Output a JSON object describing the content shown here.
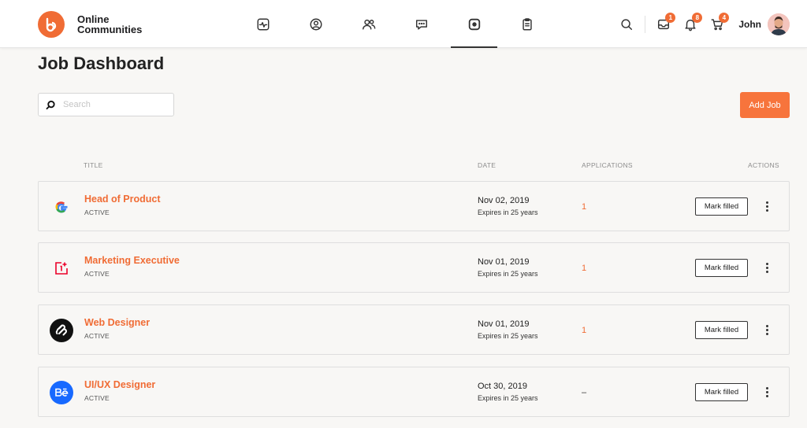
{
  "brand": {
    "line1": "Online",
    "line2": "Communities"
  },
  "nav": [
    {
      "icon": "activity-icon"
    },
    {
      "icon": "profile-icon"
    },
    {
      "icon": "groups-icon"
    },
    {
      "icon": "messages-icon"
    },
    {
      "icon": "jobs-icon",
      "active": true
    },
    {
      "icon": "documents-icon"
    }
  ],
  "header": {
    "inbox_badge": "1",
    "notifications_badge": "8",
    "cart_badge": "4",
    "user_name": "John"
  },
  "page": {
    "title": "Job Dashboard",
    "search_placeholder": "Search",
    "add_job_label": "Add Job"
  },
  "columns": {
    "title": "TITLE",
    "date": "DATE",
    "applications": "APPLICATIONS",
    "actions": "ACTIONS"
  },
  "jobs": [
    {
      "title": "Head of Product",
      "status": "ACTIVE",
      "date": "Nov 02, 2019",
      "expiry": "Expires in 25 years",
      "applications": "1",
      "action": "Mark filled",
      "logo": "google-logo-icon"
    },
    {
      "title": "Marketing Executive",
      "status": "ACTIVE",
      "date": "Nov 01, 2019",
      "expiry": "Expires in 25 years",
      "applications": "1",
      "action": "Mark filled",
      "logo": "oneplus-logo-icon"
    },
    {
      "title": "Web Designer",
      "status": "ACTIVE",
      "date": "Nov 01, 2019",
      "expiry": "Expires in 25 years",
      "applications": "1",
      "action": "Mark filled",
      "logo": "squarespace-logo-icon"
    },
    {
      "title": "UI/UX Designer",
      "status": "ACTIVE",
      "date": "Oct 30, 2019",
      "expiry": "Expires in 25 years",
      "applications": "–",
      "action": "Mark filled",
      "logo": "behance-logo-icon"
    }
  ],
  "colors": {
    "accent": "#f06c35",
    "button": "#f7743c"
  }
}
